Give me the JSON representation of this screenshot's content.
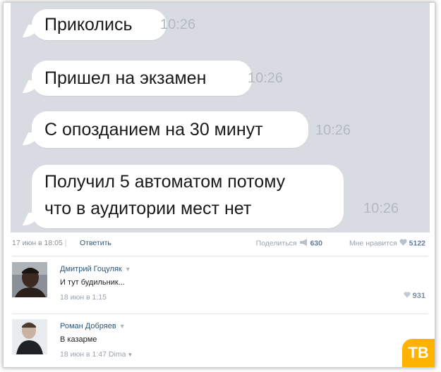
{
  "messages": [
    {
      "text": "Приколись",
      "time": "10:26"
    },
    {
      "text": "Пришел на экзамен",
      "time": "10:26"
    },
    {
      "text": "С опозданием на 30 минут",
      "time": "10:26"
    },
    {
      "text_line1": "Получил 5 автоматом потому",
      "text_line2": "что в аудитории мест нет",
      "time": "10:26"
    }
  ],
  "post_meta": {
    "date": "17 июн в 18:05",
    "separator": "|",
    "reply": "Ответить",
    "share_label": "Поделиться",
    "share_count": "630",
    "like_label": "Мне нравится",
    "like_count": "5122"
  },
  "comments": [
    {
      "author": "Дмитрий Гоцуляк",
      "text": "И тут будильник...",
      "date": "18 июн в 1:15",
      "likes": "931"
    },
    {
      "author": "Роман Добряев",
      "text": "В казарме",
      "date": "18 июн в 1:47",
      "via": "Dima"
    }
  ],
  "logo": {
    "text": "ТВ"
  },
  "colors": {
    "chat_bg": "#d8dbe2",
    "link": "#2b587a",
    "logo": "#ffb300"
  }
}
